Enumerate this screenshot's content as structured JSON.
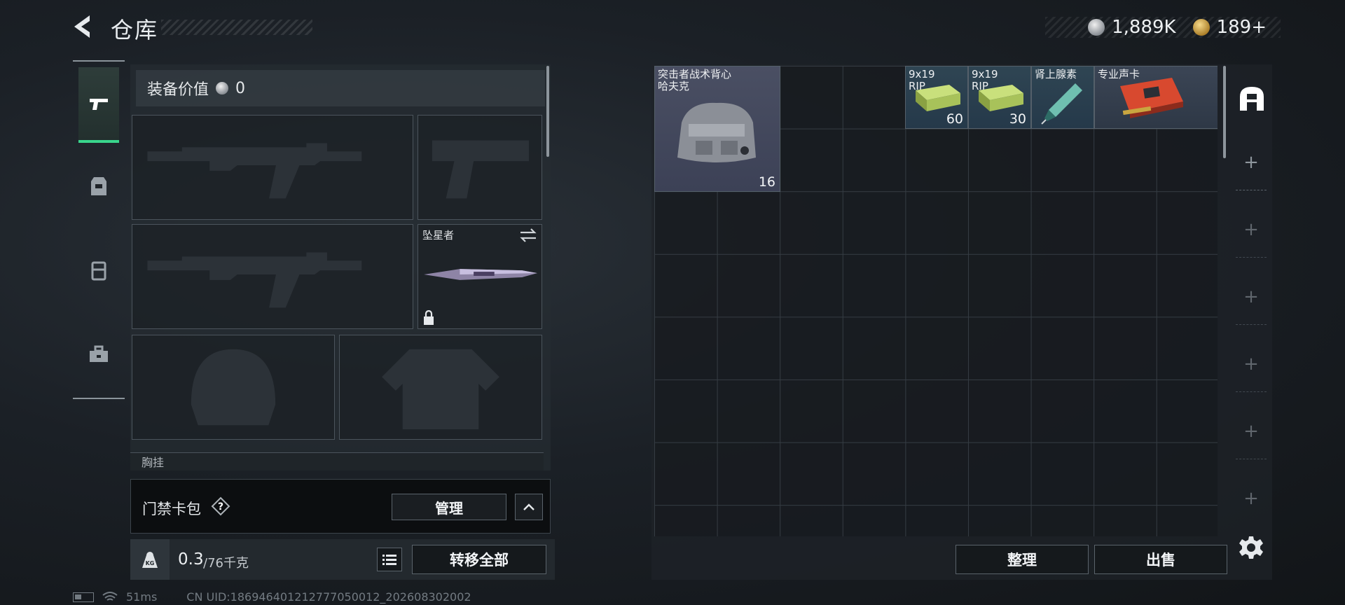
{
  "header": {
    "title": "仓库",
    "currency_silver": "1,889K",
    "currency_gold": "189+"
  },
  "equipment": {
    "value_label": "装备价值",
    "value": "0",
    "melee_name": "坠星者",
    "chest_rig_label": "胸挂"
  },
  "keycard": {
    "label": "门禁卡包",
    "help": "?",
    "manage_label": "管理"
  },
  "weight": {
    "current": "0.3",
    "max": "/76千克",
    "icon_text": "KG",
    "transfer_all_label": "转移全部"
  },
  "status": {
    "ping": "51ms",
    "uid": "CN UID:186946401212777050012_202608302002"
  },
  "inventory": {
    "items": [
      {
        "name": "突击者战术背心\n哈夫克",
        "count": "16",
        "icon": "tactical-backpack"
      },
      {
        "name": "9x19\nRIP",
        "count": "60",
        "icon": "ammo-box"
      },
      {
        "name": "9x19\nRIP",
        "count": "30",
        "icon": "ammo-box"
      },
      {
        "name": "肾上腺素",
        "count": "",
        "icon": "adrenaline-syringe"
      },
      {
        "name": "专业声卡",
        "count": "",
        "icon": "sound-card"
      }
    ],
    "sort_label": "整理",
    "sell_label": "出售"
  },
  "colors": {
    "accent_green": "#39d58c",
    "bag_bg": "#4a4f63",
    "ammo_bg": "#2f4553"
  }
}
